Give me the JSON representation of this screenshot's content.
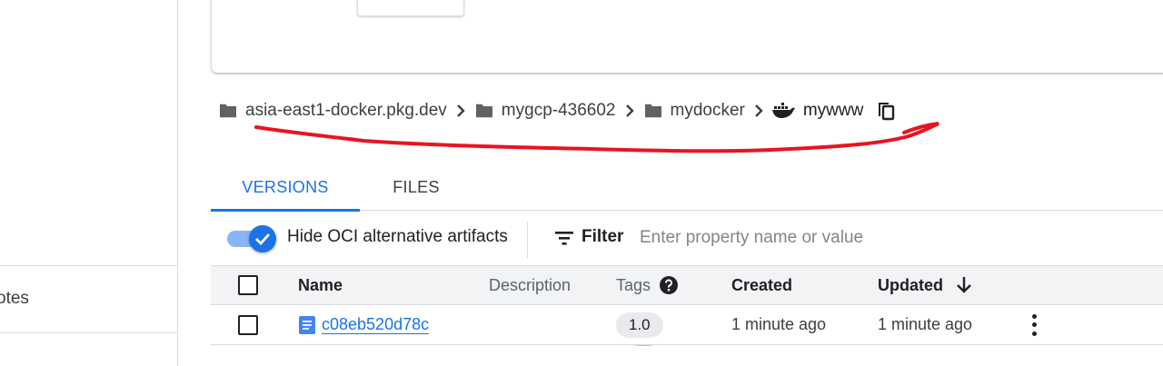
{
  "sidebar": {
    "partial_item_label": "otes"
  },
  "breadcrumb": {
    "items": [
      {
        "label": "asia-east1-docker.pkg.dev",
        "icon": "folder-icon"
      },
      {
        "label": "mygcp-436602",
        "icon": "folder-icon"
      },
      {
        "label": "mydocker",
        "icon": "folder-icon"
      },
      {
        "label": "mywww",
        "icon": "docker-icon"
      }
    ],
    "copy_icon": "copy-icon"
  },
  "tabs": [
    {
      "label": "VERSIONS",
      "active": true
    },
    {
      "label": "FILES",
      "active": false
    }
  ],
  "toolbar": {
    "toggle_label": "Hide OCI alternative artifacts",
    "toggle_on": true,
    "filter_label": "Filter",
    "filter_placeholder": "Enter property name or value",
    "filter_value": ""
  },
  "table": {
    "columns": [
      "Name",
      "Description",
      "Tags",
      "Created",
      "Updated"
    ],
    "sort_column": "Updated",
    "rows": [
      {
        "name": "c08eb520d78c",
        "description": "",
        "tag": "1.0",
        "created": "1 minute ago",
        "updated": "1 minute ago"
      }
    ]
  },
  "colors": {
    "accent": "#1a73e8",
    "annotation": "#e8141f",
    "header_bg": "#f1f3f4"
  }
}
